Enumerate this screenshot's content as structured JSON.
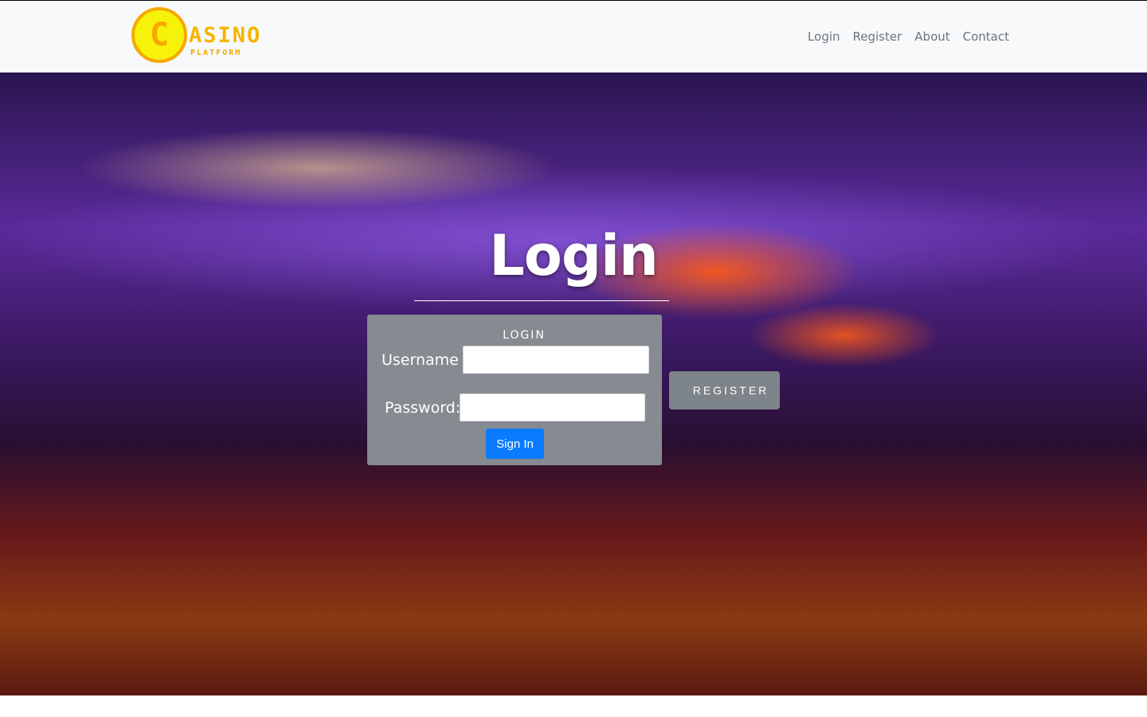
{
  "brand": {
    "name": "ASINO",
    "tagline": "PLATFORM",
    "coin_glyph": "C"
  },
  "nav": {
    "items": [
      {
        "label": "Login"
      },
      {
        "label": "Register"
      },
      {
        "label": "About"
      },
      {
        "label": "Contact"
      }
    ]
  },
  "hero": {
    "title": "Login"
  },
  "login_form": {
    "heading": "LOGIN",
    "username_label": "Username :",
    "username_value": "",
    "password_label": "Password:",
    "password_value": "",
    "submit_label": "Sign In"
  },
  "register_button": {
    "label": "REGISTER"
  },
  "colors": {
    "primary": "#0a7bff",
    "card": "#858b91",
    "logo": "#f7b400"
  }
}
